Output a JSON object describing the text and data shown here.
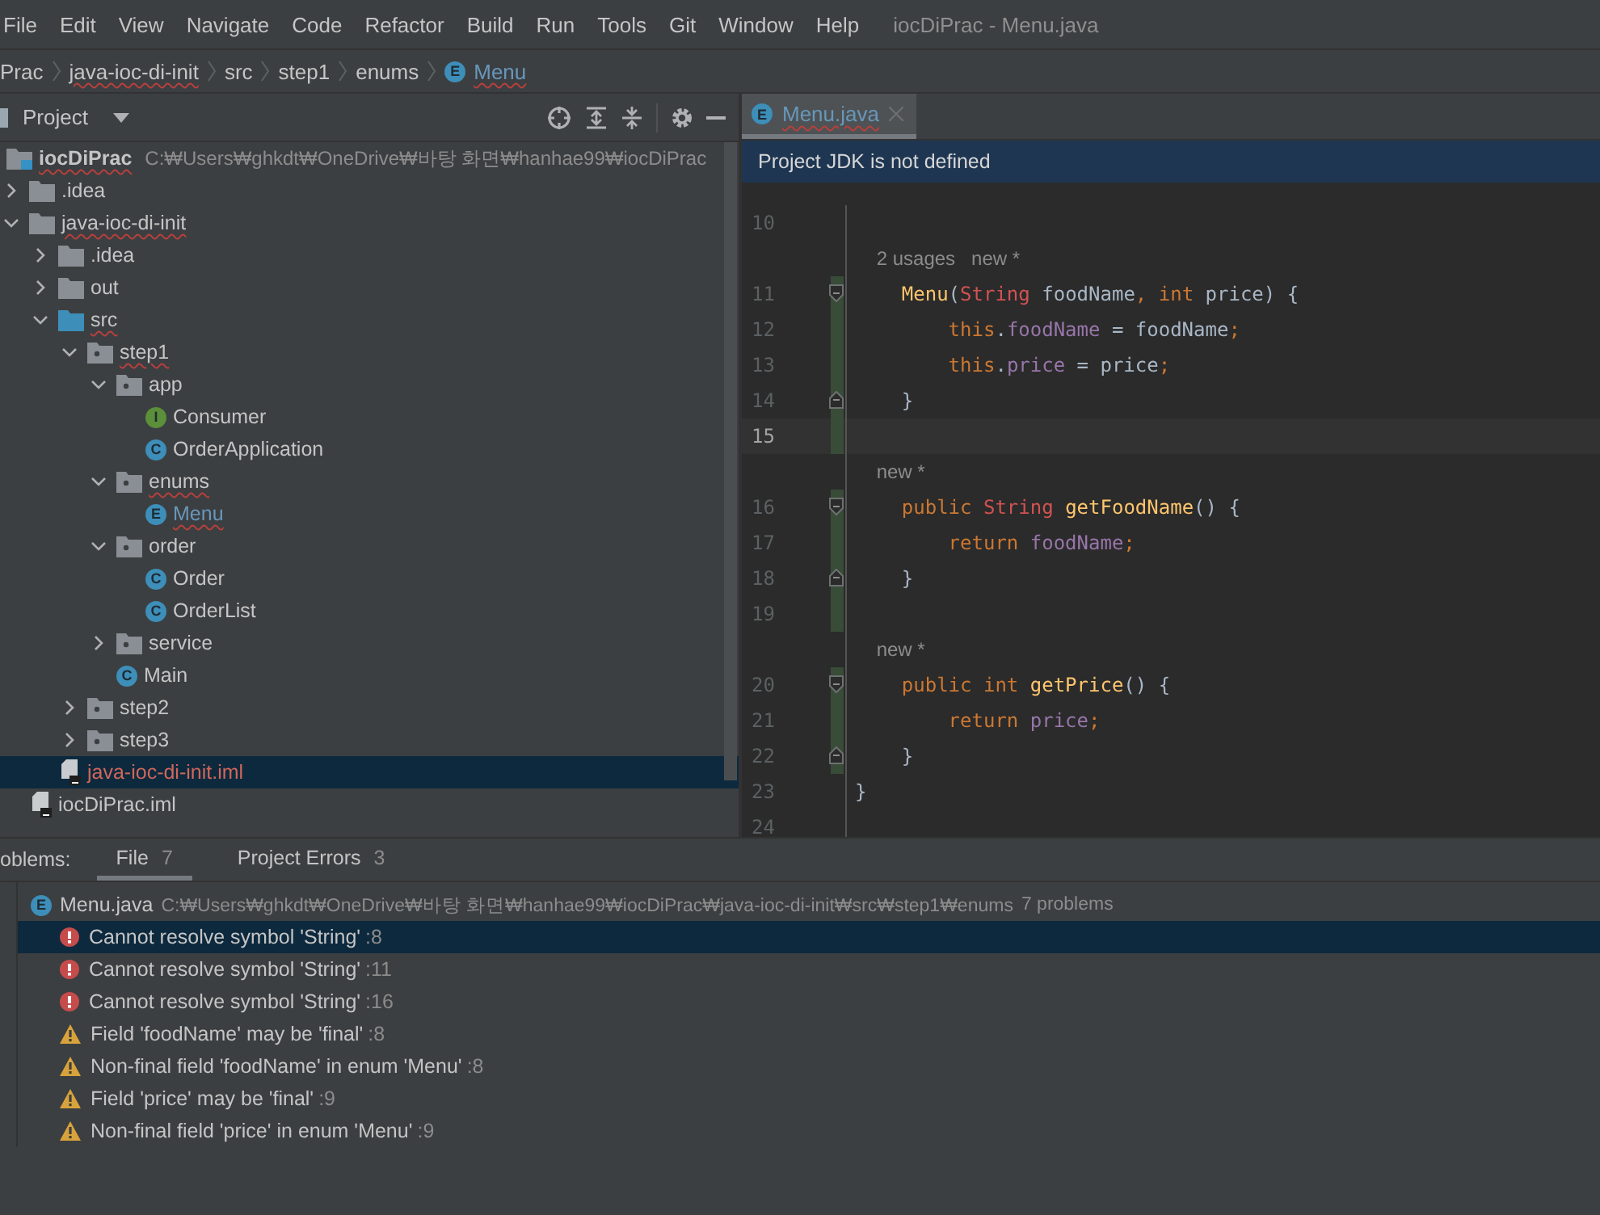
{
  "menu": {
    "items": [
      "File",
      "Edit",
      "View",
      "Navigate",
      "Code",
      "Refactor",
      "Build",
      "Run",
      "Tools",
      "Git",
      "Window",
      "Help"
    ],
    "title": "iocDiPrac - Menu.java"
  },
  "breadcrumb": [
    {
      "label": "Prac",
      "errors": false
    },
    {
      "label": "java-ioc-di-init",
      "errors": true
    },
    {
      "label": "src",
      "errors": false
    },
    {
      "label": "step1",
      "errors": false
    },
    {
      "label": "enums",
      "errors": false
    },
    {
      "label": "Menu",
      "errors": true,
      "icon_letter": "E"
    }
  ],
  "project": {
    "title": "Project",
    "tree": [
      {
        "name": "iocDiPrac",
        "kind": "module",
        "errors": true,
        "selected": false,
        "path": "C:₩Users₩ghkdt₩OneDrive₩바탕 화면₩hanhae99₩iocDiPrac",
        "children": [
          {
            "name": ".idea",
            "kind": "folder",
            "expanded": false,
            "errors": false,
            "selected": false
          },
          {
            "name": "java-ioc-di-init",
            "kind": "folder",
            "expanded": true,
            "errors": true,
            "selected": false,
            "children": [
              {
                "name": ".idea",
                "kind": "folder",
                "expanded": false,
                "errors": false,
                "selected": false
              },
              {
                "name": "out",
                "kind": "folder",
                "expanded": false,
                "errors": false,
                "selected": false
              },
              {
                "name": "src",
                "kind": "source",
                "expanded": true,
                "errors": true,
                "selected": false,
                "children": [
                  {
                    "name": "step1",
                    "kind": "package",
                    "expanded": true,
                    "errors": true,
                    "selected": false,
                    "children": [
                      {
                        "name": "app",
                        "kind": "package",
                        "expanded": true,
                        "errors": false,
                        "selected": false,
                        "children": [
                          {
                            "name": "Consumer",
                            "kind": "interface",
                            "icon_letter": "I",
                            "errors": false,
                            "selected": false
                          },
                          {
                            "name": "OrderApplication",
                            "kind": "class",
                            "icon_letter": "C",
                            "errors": false,
                            "selected": false
                          }
                        ]
                      },
                      {
                        "name": "enums",
                        "kind": "package",
                        "expanded": true,
                        "errors": true,
                        "selected": false,
                        "children": [
                          {
                            "name": "Menu",
                            "kind": "enum",
                            "icon_letter": "E",
                            "errors": true,
                            "color": "#6897bb",
                            "selected": false
                          }
                        ]
                      },
                      {
                        "name": "order",
                        "kind": "package",
                        "expanded": true,
                        "errors": false,
                        "selected": false,
                        "children": [
                          {
                            "name": "Order",
                            "kind": "class",
                            "icon_letter": "C",
                            "errors": false,
                            "selected": false
                          },
                          {
                            "name": "OrderList",
                            "kind": "class",
                            "icon_letter": "C",
                            "errors": false,
                            "selected": false
                          }
                        ]
                      },
                      {
                        "name": "service",
                        "kind": "package",
                        "expanded": false,
                        "errors": false,
                        "selected": false
                      },
                      {
                        "name": "Main",
                        "kind": "class",
                        "icon_letter": "C",
                        "errors": false,
                        "selected": false
                      }
                    ]
                  },
                  {
                    "name": "step2",
                    "kind": "package",
                    "expanded": false,
                    "errors": false,
                    "selected": false
                  },
                  {
                    "name": "step3",
                    "kind": "package",
                    "expanded": false,
                    "errors": false,
                    "selected": false
                  }
                ]
              },
              {
                "name": "java-ioc-di-init.iml",
                "kind": "iml",
                "errors": false,
                "color": "#d1675a",
                "selected": true
              }
            ]
          },
          {
            "name": "iocDiPrac.iml",
            "kind": "iml",
            "errors": false,
            "selected": false
          }
        ]
      }
    ]
  },
  "editor": {
    "tabs": [
      {
        "label": "Menu.java",
        "icon_letter": "E",
        "errors": true,
        "selected": true
      }
    ],
    "banner": "Project JDK is not defined",
    "lines": [
      {
        "kind": "code",
        "number": "10",
        "changed": false,
        "current": false,
        "fold_start": false,
        "fold_end": false
      },
      {
        "kind": "hint",
        "text": "    2 usages   new *"
      },
      {
        "kind": "code",
        "number": "11",
        "changed": true,
        "current": false,
        "fold_start": true,
        "fold_end": false,
        "tokens": [
          {
            "text": "    Menu",
            "kind": "fn"
          },
          {
            "text": "(",
            "kind": "plain"
          },
          {
            "text": "String",
            "kind": "error"
          },
          {
            "text": " foodName",
            "kind": "plain"
          },
          {
            "text": ", ",
            "kind": "punct"
          },
          {
            "text": "int ",
            "kind": "kw"
          },
          {
            "text": "price) {",
            "kind": "plain"
          }
        ]
      },
      {
        "kind": "code",
        "number": "12",
        "changed": true,
        "current": false,
        "fold_start": false,
        "fold_end": false,
        "tokens": [
          {
            "text": "        this",
            "kind": "kw"
          },
          {
            "text": ".",
            "kind": "plain"
          },
          {
            "text": "foodName",
            "kind": "field"
          },
          {
            "text": " = foodName",
            "kind": "plain"
          },
          {
            "text": ";",
            "kind": "punct"
          }
        ]
      },
      {
        "kind": "code",
        "number": "13",
        "changed": true,
        "current": false,
        "fold_start": false,
        "fold_end": false,
        "tokens": [
          {
            "text": "        this",
            "kind": "kw"
          },
          {
            "text": ".",
            "kind": "plain"
          },
          {
            "text": "price",
            "kind": "field"
          },
          {
            "text": " = price",
            "kind": "plain"
          },
          {
            "text": ";",
            "kind": "punct"
          }
        ]
      },
      {
        "kind": "code",
        "number": "14",
        "changed": true,
        "current": false,
        "fold_start": false,
        "fold_end": true,
        "tokens": [
          {
            "text": "    }",
            "kind": "plain"
          }
        ]
      },
      {
        "kind": "code",
        "number": "15",
        "changed": true,
        "current": true,
        "fold_start": false,
        "fold_end": false
      },
      {
        "kind": "hint",
        "text": "    new *"
      },
      {
        "kind": "code",
        "number": "16",
        "changed": true,
        "current": false,
        "fold_start": true,
        "fold_end": false,
        "tokens": [
          {
            "text": "    public ",
            "kind": "kw"
          },
          {
            "text": "String",
            "kind": "error"
          },
          {
            "text": " getFoodName",
            "kind": "fn"
          },
          {
            "text": "() {",
            "kind": "plain"
          }
        ]
      },
      {
        "kind": "code",
        "number": "17",
        "changed": true,
        "current": false,
        "fold_start": false,
        "fold_end": false,
        "tokens": [
          {
            "text": "        return ",
            "kind": "kw"
          },
          {
            "text": "foodName",
            "kind": "field"
          },
          {
            "text": ";",
            "kind": "punct"
          }
        ]
      },
      {
        "kind": "code",
        "number": "18",
        "changed": true,
        "current": false,
        "fold_start": false,
        "fold_end": true,
        "tokens": [
          {
            "text": "    }",
            "kind": "plain"
          }
        ]
      },
      {
        "kind": "code",
        "number": "19",
        "changed": true,
        "current": false,
        "fold_start": false,
        "fold_end": false
      },
      {
        "kind": "hint",
        "text": "    new *"
      },
      {
        "kind": "code",
        "number": "20",
        "changed": true,
        "current": false,
        "fold_start": true,
        "fold_end": false,
        "tokens": [
          {
            "text": "    public int ",
            "kind": "kw"
          },
          {
            "text": "getPrice",
            "kind": "fn"
          },
          {
            "text": "() {",
            "kind": "plain"
          }
        ]
      },
      {
        "kind": "code",
        "number": "21",
        "changed": true,
        "current": false,
        "fold_start": false,
        "fold_end": false,
        "tokens": [
          {
            "text": "        return ",
            "kind": "kw"
          },
          {
            "text": "price",
            "kind": "field"
          },
          {
            "text": ";",
            "kind": "punct"
          }
        ]
      },
      {
        "kind": "code",
        "number": "22",
        "changed": true,
        "current": false,
        "fold_start": false,
        "fold_end": true,
        "tokens": [
          {
            "text": "    }",
            "kind": "plain"
          }
        ]
      },
      {
        "kind": "code",
        "number": "23",
        "changed": false,
        "current": false,
        "fold_start": false,
        "fold_end": false,
        "tokens": [
          {
            "text": "}",
            "kind": "plain"
          }
        ]
      },
      {
        "kind": "code",
        "number": "24",
        "changed": false,
        "current": false,
        "fold_start": false,
        "fold_end": false
      }
    ]
  },
  "problems": {
    "title": "oblems:",
    "tabs": [
      {
        "label": "File",
        "count": "7",
        "selected": true
      },
      {
        "label": "Project Errors",
        "count": "3",
        "selected": false
      }
    ],
    "file": {
      "name": "Menu.java",
      "icon_letter": "E",
      "path": "C:₩Users₩ghkdt₩OneDrive₩바탕 화면₩hanhae99₩iocDiPrac₩java-ioc-di-init₩src₩step1₩enums",
      "count": "7 problems"
    },
    "items": [
      {
        "kind": "error",
        "message": "Cannot resolve symbol 'String'",
        "line": ":8",
        "selected": true
      },
      {
        "kind": "error",
        "message": "Cannot resolve symbol 'String'",
        "line": ":11",
        "selected": false
      },
      {
        "kind": "error",
        "message": "Cannot resolve symbol 'String'",
        "line": ":16",
        "selected": false
      },
      {
        "kind": "warning",
        "message": "Field 'foodName' may be 'final'",
        "line": ":8",
        "selected": false
      },
      {
        "kind": "warning",
        "message": "Non-final field 'foodName' in enum 'Menu'",
        "line": ":8",
        "selected": false
      },
      {
        "kind": "warning",
        "message": "Field 'price' may be 'final'",
        "line": ":9",
        "selected": false
      },
      {
        "kind": "warning",
        "message": "Non-final field 'price' in enum 'Menu'",
        "line": ":9",
        "selected": false
      }
    ]
  }
}
